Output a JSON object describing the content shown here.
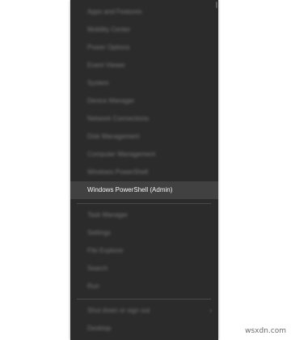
{
  "menu": {
    "items": [
      {
        "label": "Apps and Features"
      },
      {
        "label": "Mobility Center"
      },
      {
        "label": "Power Options"
      },
      {
        "label": "Event Viewer"
      },
      {
        "label": "System"
      },
      {
        "label": "Device Manager"
      },
      {
        "label": "Network Connections"
      },
      {
        "label": "Disk Management"
      },
      {
        "label": "Computer Management"
      },
      {
        "label": "Windows PowerShell"
      },
      {
        "label": "Windows PowerShell (Admin)"
      },
      {
        "label": "Task Manager"
      },
      {
        "label": "Settings"
      },
      {
        "label": "File Explorer"
      },
      {
        "label": "Search"
      },
      {
        "label": "Run"
      },
      {
        "label": "Shut down or sign out"
      },
      {
        "label": "Desktop"
      }
    ],
    "highlighted_index": 10,
    "submenu_arrow": "›"
  },
  "watermark": "wsxdn.com",
  "colors": {
    "menu_background": "#2b2b2b",
    "highlight_background": "#414141",
    "text": "#f2f2f2"
  }
}
